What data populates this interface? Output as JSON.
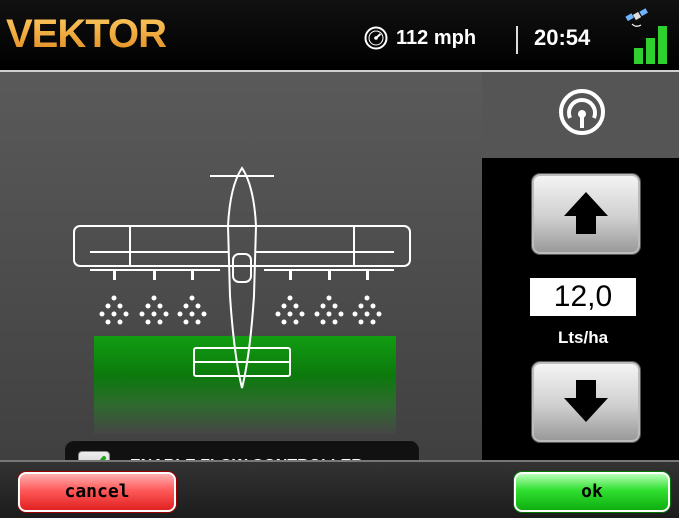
{
  "header": {
    "logo_text": "VEKTOR",
    "speed": "112 mph",
    "time": "20:54",
    "speed_icon": "speedometer-icon",
    "gps_icon": "satellite-icon",
    "signal_icon": "signal-bars-icon"
  },
  "main": {
    "flow_controller_label": "ENABLE FLOW CONTROLLER",
    "flow_controller_checked": true,
    "illustration": "crop-duster-plane"
  },
  "side": {
    "gauge_icon": "gauge-icon",
    "up_icon": "arrow-up-icon",
    "down_icon": "arrow-down-icon",
    "rate_value": "12,0",
    "rate_unit": "Lts/ha"
  },
  "footer": {
    "cancel_label": "cancel",
    "ok_label": "ok"
  },
  "colors": {
    "logo": "#e89a1a",
    "cancel": "#e02020",
    "ok": "#0fae0f",
    "field": "#119d11"
  }
}
